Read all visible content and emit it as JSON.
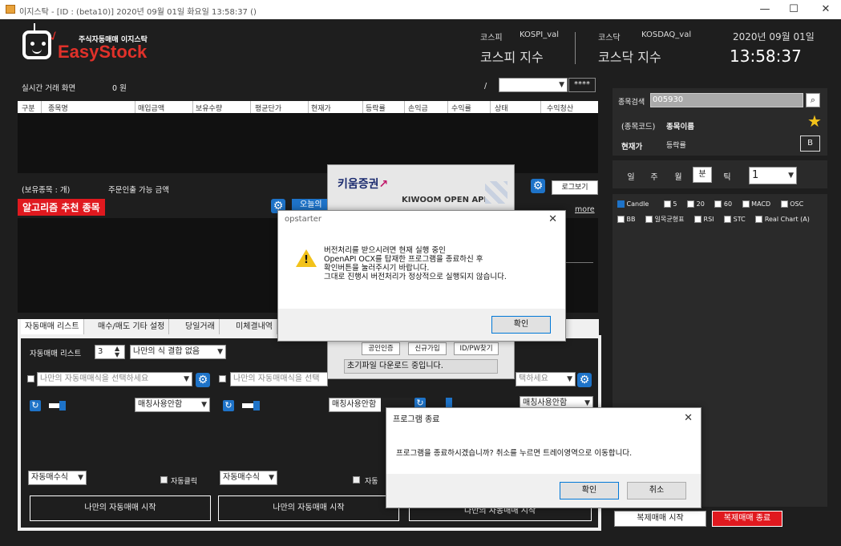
{
  "window": {
    "title": "이지스탁 - [ID : (beta10)] 2020년 09월 01일 화요일 13:58:37 ()",
    "minimize": "—",
    "maximize": "☐",
    "close": "✕"
  },
  "logo": {
    "tagline": "주식자동매매 이지스탁",
    "name": "EasyStock"
  },
  "header": {
    "kospi_label": "코스피",
    "kospi_code": "KOSPI_val",
    "kospi_value": "코스피 지수",
    "kosdaq_label": "코스닥",
    "kosdaq_code": "KOSDAQ_val",
    "kosdaq_value": "코스닥 지수",
    "date": "2020년 09월 01일",
    "time": "13:58:37"
  },
  "realtime": {
    "title": "실시간 거래 화면",
    "amount": "0 원",
    "slash": "/",
    "account_mask": "****",
    "columns": [
      "구분",
      "종목명",
      "매입금액",
      "보유수량",
      "평균단가",
      "현재가",
      "등락률",
      "손익금",
      "수익률",
      "상태",
      "수익청산"
    ],
    "holdings": "(보유종목 : 개)",
    "orderable": "주문인출 가능 금액",
    "log_button": "로그보기"
  },
  "algo": {
    "banner": "알고리즘 추천 종목",
    "today_partial": "오늘의",
    "more": "more"
  },
  "tabs": [
    "자동매매 리스트",
    "매수/매도 기타 설정",
    "당일거래",
    "미체결내역"
  ],
  "autotrade": {
    "list_label": "자동매매 리스트",
    "list_count": "3",
    "list_select": "나만의 식 결합 없음",
    "strategy_placeholder": "나만의 자동매매식을 선택하세요",
    "strategy_placeholder_2": "나만의 자동매매식을 선택",
    "strategy_placeholder_3": "택하세요",
    "match_unused": "매칭사용안함",
    "buy_formula": "자동매수식",
    "auto_cancel": "자동클릭",
    "auto_cancel_partial": "자동",
    "start_button": "나만의 자동매매 시작",
    "start_button_3": "나만의 자동매매 시작"
  },
  "rightpanel": {
    "search_label": "종목검색",
    "search_value": "005930",
    "code_label": "(종목코드)",
    "name_label": "종목이름",
    "price_label": "현재가",
    "change_label": "등락률",
    "b_button": "B",
    "periods": [
      "일",
      "주",
      "월",
      "분",
      "틱"
    ],
    "active_period": "분",
    "interval": "1",
    "indicators_row1": [
      "Candle",
      "5",
      "20",
      "60",
      "MACD",
      "OSC"
    ],
    "indicators_row2": [
      "BB",
      "일목균형표",
      "RSI",
      "STC",
      "Real Chart (A)"
    ],
    "copy_start": "복제매매 시작",
    "copy_stop": "복제매매 종료"
  },
  "kiwoom": {
    "brand": "키움증권",
    "api": "KIWOOM OPEN API",
    "btn_cert": "공인인증",
    "btn_join": "신규가입",
    "btn_idpw": "ID/PW찾기",
    "status": "초기파일 다운로드 중입니다."
  },
  "opstarter": {
    "title": "opstarter",
    "message_lines": [
      "버전처리를 받으시려면 현재 실행 중인",
      "OpenAPI OCX를 탑재한 프로그램을 종료하신 후",
      "확인버튼을 눌러주시기 바랍니다.",
      "그대로 진행시 버전처리가 정상적으로 실행되지 않습니다."
    ],
    "ok": "확인"
  },
  "exit_dialog": {
    "title": "프로그램 종료",
    "message": "프로그램을 종료하시겠습니까? 취소를 누르면 트레이영역으로 이동합니다.",
    "ok": "확인",
    "cancel": "취소"
  },
  "colors": {
    "accent_red": "#e0191f",
    "accent_blue": "#1e73c8",
    "background": "#1e1e1e"
  }
}
